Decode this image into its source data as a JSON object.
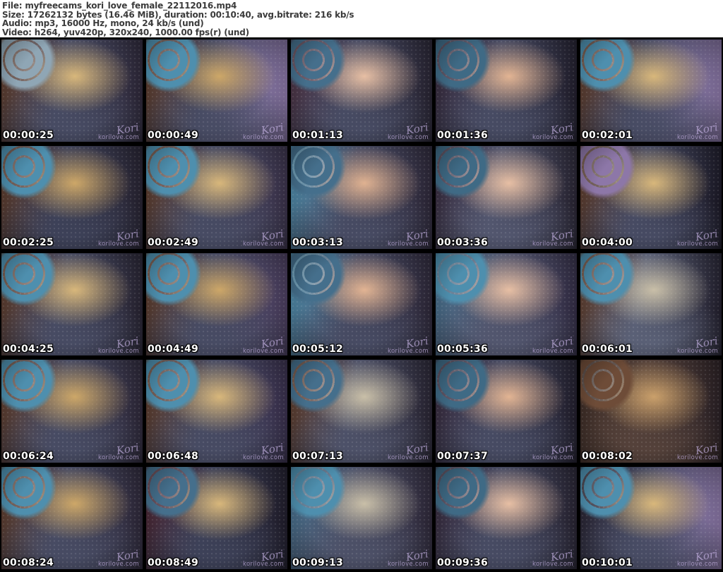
{
  "header": {
    "file": "File: myfreecams_kori_love_female_22112016.mp4",
    "size": "Size: 17262132 bytes (16.46 MiB), duration: 00:10:40, avg.bitrate: 216 kb/s",
    "audio": "Audio: mp3, 16000 Hz, mono, 24 kb/s (und)",
    "video": "Video: h264, yuv420p, 320x240, 1000.00 fps(r) (und)"
  },
  "watermark": {
    "script": "Kori",
    "domain": "korilove.com",
    "color": "#c4b0e0"
  },
  "grid": {
    "columns": 5,
    "rows": 5
  },
  "colors": {
    "header_bg": "#ffffff",
    "header_text": "#3b3b3b",
    "grid_bg": "#000000",
    "timestamp_text": "#ffffff"
  },
  "thumbnails": [
    {
      "timestamp": "00:00:25",
      "palette": {
        "a": "#8fa6b5",
        "b": "#d8b77b",
        "c": "#474b63",
        "d": "#2a2333",
        "e": "#5d3a27"
      }
    },
    {
      "timestamp": "00:00:49",
      "palette": {
        "a": "#4e8fae",
        "b": "#cda768",
        "c": "#474b63",
        "d": "#8d77a8",
        "e": "#5d3a27"
      }
    },
    {
      "timestamp": "00:01:13",
      "palette": {
        "a": "#456f8c",
        "b": "#e7bfa4",
        "c": "#474b63",
        "d": "#241f2c",
        "e": "#4a3040"
      }
    },
    {
      "timestamp": "00:01:36",
      "palette": {
        "a": "#3f6a85",
        "b": "#e2b493",
        "c": "#474b63",
        "d": "#1d1926",
        "e": "#35283a"
      }
    },
    {
      "timestamp": "00:02:01",
      "palette": {
        "a": "#4e8fae",
        "b": "#d8b77b",
        "c": "#474b63",
        "d": "#8d77a8",
        "e": "#5d3a27"
      }
    },
    {
      "timestamp": "00:02:25",
      "palette": {
        "a": "#4e8fae",
        "b": "#cda768",
        "c": "#3d4158",
        "d": "#241f2c",
        "e": "#5d3a27"
      }
    },
    {
      "timestamp": "00:02:49",
      "palette": {
        "a": "#4e8fae",
        "b": "#d8b77b",
        "c": "#474b63",
        "d": "#392f47",
        "e": "#5d3a27"
      }
    },
    {
      "timestamp": "00:03:13",
      "palette": {
        "a": "#456f8c",
        "b": "#e0b291",
        "c": "#474b63",
        "d": "#2a2333",
        "e": "#4e8fae"
      }
    },
    {
      "timestamp": "00:03:36",
      "palette": {
        "a": "#3f6a85",
        "b": "#e7bfa4",
        "c": "#52566e",
        "d": "#241f2c",
        "e": "#35283a"
      }
    },
    {
      "timestamp": "00:04:00",
      "palette": {
        "a": "#8d77a8",
        "b": "#d8b77b",
        "c": "#474b63",
        "d": "#171420",
        "e": "#5d3a27"
      }
    },
    {
      "timestamp": "00:04:25",
      "palette": {
        "a": "#4e8fae",
        "b": "#d8b77b",
        "c": "#474b63",
        "d": "#241f2c",
        "e": "#5d3a27"
      }
    },
    {
      "timestamp": "00:04:49",
      "palette": {
        "a": "#4e8fae",
        "b": "#cda768",
        "c": "#474b63",
        "d": "#4a3b5c",
        "e": "#5d3a27"
      }
    },
    {
      "timestamp": "00:05:12",
      "palette": {
        "a": "#456f8c",
        "b": "#e2b493",
        "c": "#474b63",
        "d": "#2a2333",
        "e": "#4e8fae"
      }
    },
    {
      "timestamp": "00:05:36",
      "palette": {
        "a": "#4e8fae",
        "b": "#e7bfa4",
        "c": "#52566e",
        "d": "#2f2840",
        "e": "#456f8c"
      }
    },
    {
      "timestamp": "00:06:01",
      "palette": {
        "a": "#4e8fae",
        "b": "#c9bfa8",
        "c": "#5a6076",
        "d": "#1d1926",
        "e": "#5d3a27"
      }
    },
    {
      "timestamp": "00:06:24",
      "palette": {
        "a": "#4e8fae",
        "b": "#cda768",
        "c": "#474b63",
        "d": "#2a2333",
        "e": "#5d3a27"
      }
    },
    {
      "timestamp": "00:06:48",
      "palette": {
        "a": "#4e8fae",
        "b": "#d8b77b",
        "c": "#474b63",
        "d": "#372c49",
        "e": "#5d3a27"
      }
    },
    {
      "timestamp": "00:07:13",
      "palette": {
        "a": "#456f8c",
        "b": "#c9bfa8",
        "c": "#4d5168",
        "d": "#241f2c",
        "e": "#5d3a27"
      }
    },
    {
      "timestamp": "00:07:37",
      "palette": {
        "a": "#3f6a85",
        "b": "#e2b493",
        "c": "#474b63",
        "d": "#1d1926",
        "e": "#35283a"
      }
    },
    {
      "timestamp": "00:08:02",
      "palette": {
        "a": "#6e4c38",
        "b": "#caa06b",
        "c": "#54413a",
        "d": "#241c22",
        "e": "#3a2a24"
      }
    },
    {
      "timestamp": "00:08:24",
      "palette": {
        "a": "#4e8fae",
        "b": "#cda768",
        "c": "#474b63",
        "d": "#2a2333",
        "e": "#5d3a27"
      }
    },
    {
      "timestamp": "00:08:49",
      "palette": {
        "a": "#456f8c",
        "b": "#d8b77b",
        "c": "#3d4158",
        "d": "#1d1926",
        "e": "#4a2430"
      }
    },
    {
      "timestamp": "00:09:13",
      "palette": {
        "a": "#4e8fae",
        "b": "#c9bfa8",
        "c": "#4d5168",
        "d": "#2a2333",
        "e": "#456f8c"
      }
    },
    {
      "timestamp": "00:09:36",
      "palette": {
        "a": "#3f6a85",
        "b": "#e7bfa4",
        "c": "#474b63",
        "d": "#241f2c",
        "e": "#35283a"
      }
    },
    {
      "timestamp": "00:10:01",
      "palette": {
        "a": "#4e8fae",
        "b": "#d8b77b",
        "c": "#474b63",
        "d": "#8d77a8",
        "e": "#241f2c"
      }
    }
  ]
}
